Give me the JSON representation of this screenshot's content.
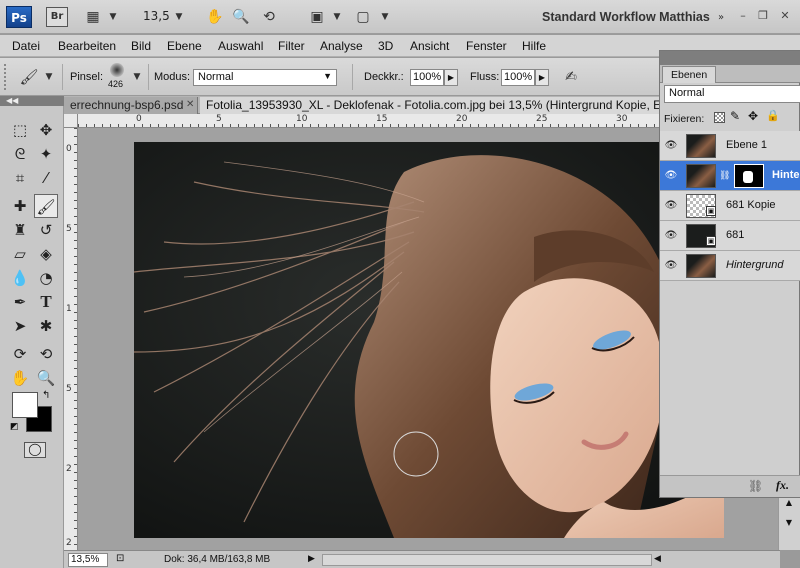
{
  "appbar": {
    "ps_logo": "Ps",
    "br_logo": "Br",
    "zoom_value": "13,5",
    "workspace_name": "Standard Workflow Matthias"
  },
  "menu": [
    "Datei",
    "Bearbeiten",
    "Bild",
    "Ebene",
    "Auswahl",
    "Filter",
    "Analyse",
    "3D",
    "Ansicht",
    "Fenster",
    "Hilfe"
  ],
  "options": {
    "brush_label": "Pinsel:",
    "brush_size": "426",
    "mode_label": "Modus:",
    "mode_value": "Normal",
    "opacity_label": "Deckkr.:",
    "opacity_value": "100%",
    "flow_label": "Fluss:",
    "flow_value": "100%"
  },
  "doc_tabs": [
    "errechnung-bsp6.psd",
    "Fotolia_13953930_XL - Deklofenak - Fotolia.com.jpg bei 13,5% (Hintergrund Kopie, Ebe"
  ],
  "ruler_top": [
    "0",
    "5",
    "10",
    "15",
    "20",
    "25",
    "30"
  ],
  "ruler_left": [
    "0",
    "5",
    "1",
    "5",
    "2",
    "2"
  ],
  "status": {
    "zoom": "13,5%",
    "doc_info": "Dok: 36,4 MB/163,8 MB"
  },
  "layers_panel": {
    "tab": "Ebenen",
    "blend_mode": "Normal",
    "lock_label": "Fixieren:",
    "layers": [
      {
        "name": "Ebene 1",
        "selected": false
      },
      {
        "name": "Hinte",
        "selected": true
      },
      {
        "name": "681 Kopie",
        "selected": false
      },
      {
        "name": "681",
        "selected": false
      },
      {
        "name": "Hintergrund",
        "selected": false
      }
    ],
    "fx_label": "fx."
  },
  "colors": {
    "accent": "#3c78d8",
    "logo": "#1d56a8"
  }
}
